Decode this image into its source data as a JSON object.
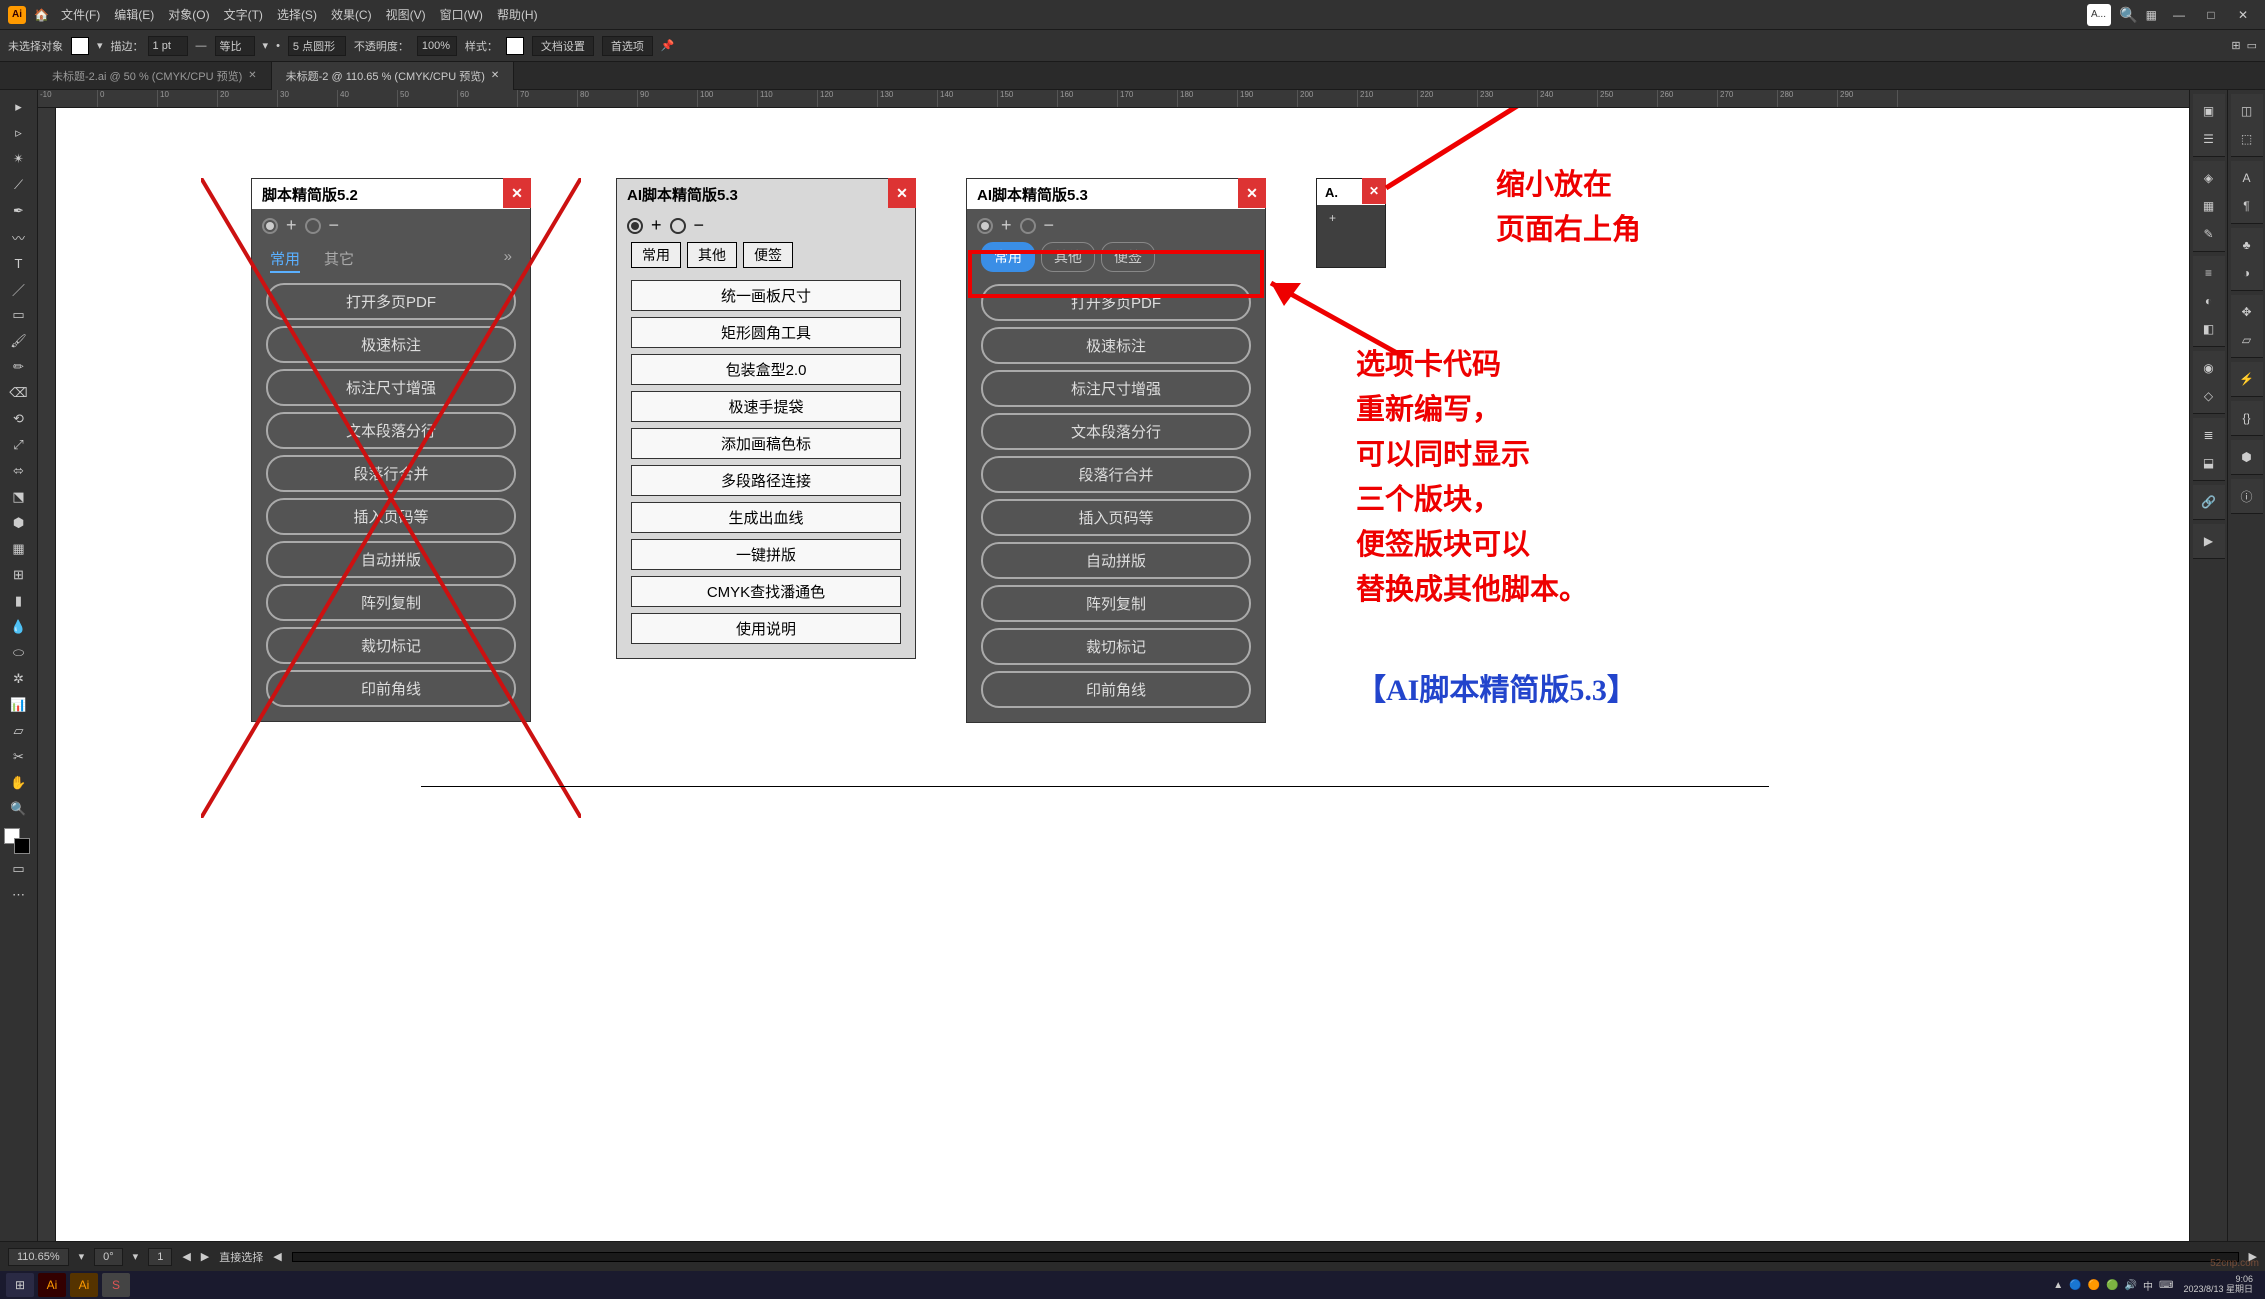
{
  "menubar": {
    "logo": "Ai",
    "menus": [
      "文件(F)",
      "编辑(E)",
      "对象(O)",
      "文字(T)",
      "选择(S)",
      "效果(C)",
      "视图(V)",
      "窗口(W)",
      "帮助(H)"
    ],
    "search_placeholder": "A..."
  },
  "controlbar": {
    "label_noselect": "未选择对象",
    "lbl_stroke": "描边：",
    "stroke_val": "1 pt",
    "lbl_uniform": "等比",
    "lbl_corner": "5 点圆形",
    "lbl_opacity": "不透明度：",
    "opacity_val": "100%",
    "lbl_style": "样式：",
    "btn_docsetup": "文档设置",
    "btn_prefs": "首选项"
  },
  "tabs": [
    {
      "label": "未标题-2.ai @ 50 % (CMYK/CPU 预览)",
      "active": false
    },
    {
      "label": "未标题-2 @ 110.65 % (CMYK/CPU 预览)",
      "active": true
    }
  ],
  "ruler_ticks": [
    "-10",
    "0",
    "10",
    "20",
    "30",
    "40",
    "50",
    "60",
    "70",
    "80",
    "90",
    "100",
    "110",
    "120",
    "130",
    "140",
    "150",
    "160",
    "170",
    "180",
    "190",
    "200",
    "210",
    "220",
    "230",
    "240",
    "250",
    "260",
    "270",
    "280",
    "290"
  ],
  "panels": {
    "p1": {
      "title": "脚本精简版5.2",
      "tabs": [
        "常用",
        "其它"
      ],
      "tabs_active": 0,
      "buttons": [
        "打开多页PDF",
        "极速标注",
        "标注尺寸增强",
        "文本段落分行",
        "段落行合并",
        "插入页码等",
        "自动拼版",
        "阵列复制",
        "裁切标记",
        "印前角线"
      ]
    },
    "p2": {
      "title": "AI脚本精简版5.3",
      "tabs": [
        "常用",
        "其他",
        "便签"
      ],
      "buttons": [
        "统一画板尺寸",
        "矩形圆角工具",
        "包装盒型2.0",
        "极速手提袋",
        "添加画稿色标",
        "多段路径连接",
        "生成出血线",
        "一键拼版",
        "CMYK查找潘通色",
        "使用说明"
      ]
    },
    "p3": {
      "title": "AI脚本精简版5.3",
      "tabs": [
        "常用",
        "其他",
        "便签"
      ],
      "tabs_active": 0,
      "buttons": [
        "打开多页PDF",
        "极速标注",
        "标注尺寸增强",
        "文本段落分行",
        "段落行合并",
        "插入页码等",
        "自动拼版",
        "阵列复制",
        "裁切标记",
        "印前角线"
      ]
    },
    "mini": {
      "title": "A."
    }
  },
  "annotations": {
    "a1": "缩小放在\n页面右上角",
    "a2": "选项卡代码\n重新编写，\n可以同时显示\n三个版块，\n便签版块可以\n替换成其他脚本。",
    "a3": "【AI脚本精简版5.3】"
  },
  "status": {
    "zoom": "110.65%",
    "nav": "0°",
    "art": "1",
    "tool": "直接选择"
  },
  "taskbar": {
    "time": "9:06",
    "date": "2023/8/13 星期日"
  },
  "watermark": "52cnp.com"
}
